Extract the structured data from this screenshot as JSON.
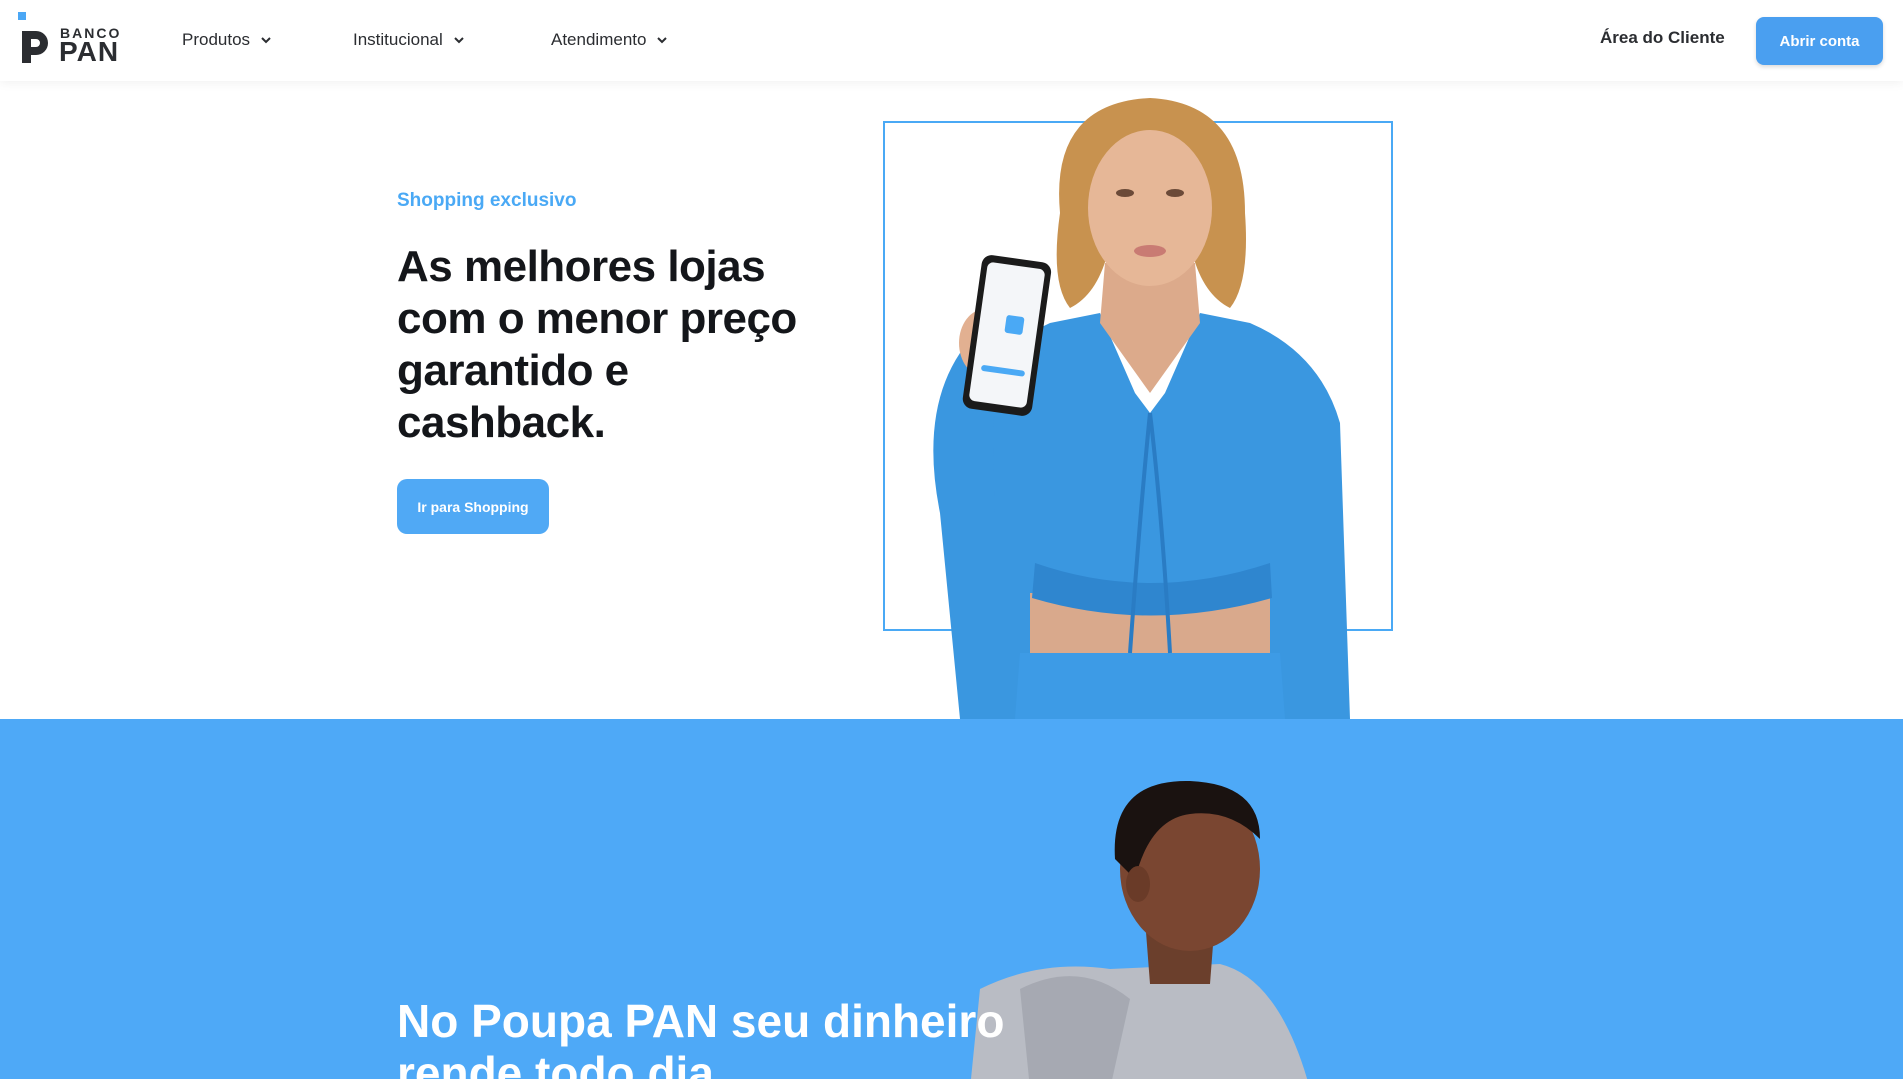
{
  "brand": {
    "top": "BANCO",
    "bottom": "PAN",
    "accent_color": "#4aa9f5"
  },
  "nav": {
    "items": [
      {
        "label": "Produtos",
        "icon": "chevron-down-icon"
      },
      {
        "label": "Institucional",
        "icon": "chevron-down-icon"
      },
      {
        "label": "Atendimento",
        "icon": "chevron-down-icon"
      }
    ],
    "client_area": "Área do Cliente",
    "open_account": "Abrir conta"
  },
  "hero_shopping": {
    "eyebrow": "Shopping exclusivo",
    "title": "As melhores lojas com o menor preço garantido e cashback.",
    "cta": "Ir para Shopping"
  },
  "hero_poupa": {
    "title": "No Poupa PAN seu dinheiro rende todo dia",
    "background_color": "#4ea9f7"
  }
}
